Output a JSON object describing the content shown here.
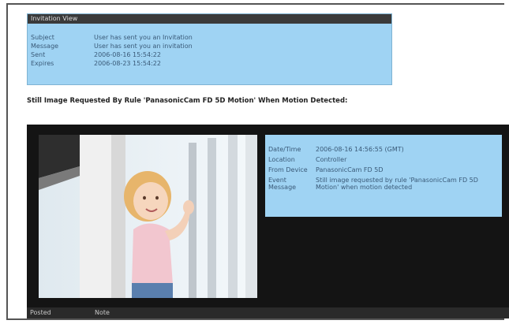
{
  "invitation": {
    "header": "Invitation View",
    "rows": [
      {
        "label": "Subject",
        "value": "User has sent you an Invitation"
      },
      {
        "label": "Message",
        "value": "User has sent you an invitation"
      },
      {
        "label": "Sent",
        "value": "2006-08-16 15:54:22"
      },
      {
        "label": "Expires",
        "value": "2006-08-23 15:54:22"
      }
    ]
  },
  "rule_title": "Still Image Requested By Rule 'PanasonicCam FD 5D Motion' When Motion Detected:",
  "event": {
    "rows": [
      {
        "label": "Date/Time",
        "value": "2006-08-16 14:56:55 (GMT)"
      },
      {
        "label": "Location",
        "value": "Controller"
      },
      {
        "label": "From Device",
        "value": "PanasonicCam FD 5D"
      },
      {
        "label": "Event Message",
        "value": "Still image requested by rule 'PanasonicCam FD 5D Motion' when motion detected"
      }
    ]
  },
  "footer": {
    "posted": "Posted",
    "note": "Note"
  }
}
